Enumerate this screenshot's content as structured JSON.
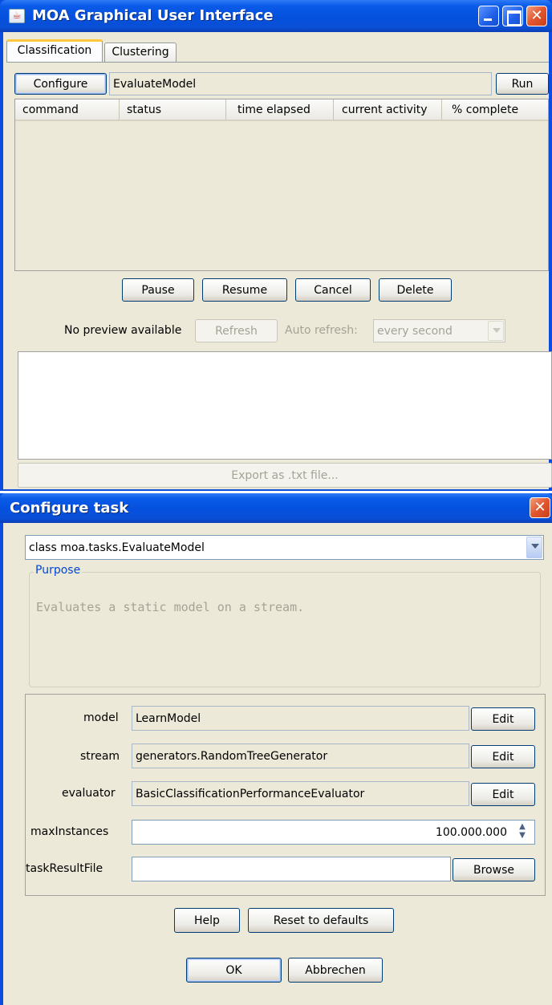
{
  "main_window": {
    "title": "MOA Graphical User Interface",
    "tabs": [
      {
        "label": "Classification",
        "selected": true
      },
      {
        "label": "Clustering",
        "selected": false
      }
    ],
    "configure_label": "Configure",
    "task_value": "EvaluateModel",
    "run_label": "Run",
    "table_headers": [
      "command",
      "status",
      "time elapsed",
      "current activity",
      "% complete"
    ],
    "pause_label": "Pause",
    "resume_label": "Resume",
    "cancel_label": "Cancel",
    "delete_label": "Delete",
    "preview_text": "No preview available",
    "refresh_label": "Refresh",
    "auto_refresh_label": "Auto refresh:",
    "auto_refresh_value": "every second",
    "export_label": "Export as .txt file..."
  },
  "configure_dialog": {
    "title": "Configure task",
    "class_value": "class moa.tasks.EvaluateModel",
    "purpose_legend": "Purpose",
    "purpose_text": "Evaluates a static model on a stream.",
    "options": [
      {
        "label": "model",
        "value": "LearnModel",
        "button": "Edit"
      },
      {
        "label": "stream",
        "value": "generators.RandomTreeGenerator",
        "button": "Edit"
      },
      {
        "label": "evaluator",
        "value": "BasicClassificationPerformanceEvaluator",
        "button": "Edit"
      }
    ],
    "max_instances_label": "maxInstances",
    "max_instances_value": "100.000.000",
    "task_result_file_label": "taskResultFile",
    "task_result_file_value": "",
    "browse_label": "Browse",
    "help_label": "Help",
    "reset_label": "Reset to defaults",
    "ok_label": "OK",
    "cancel_label": "Abbrechen"
  },
  "colors": {
    "titlebar": "#0a4fd6",
    "client_bg": "#ece9d8",
    "purpose_legend": "#0046d5",
    "close_button": "#e2562e"
  }
}
